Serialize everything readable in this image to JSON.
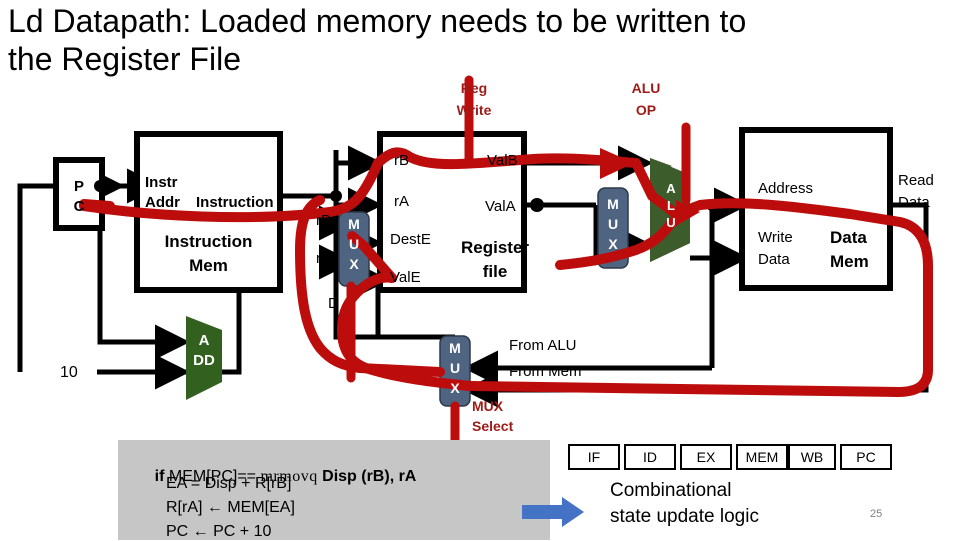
{
  "slide": {
    "title": "Ld Datapath: Loaded memory needs to be written to the Register File",
    "page_number": "25"
  },
  "colors": {
    "annotation_red": "#bd0c0c",
    "label_red": "#9e1b17",
    "alu_green": "#3d5c2b",
    "mux_blue": "#4f6480",
    "blue_arrow": "#4472c4",
    "code_bg": "#c6c6c6",
    "wire_black": "#000000"
  },
  "diagram": {
    "pc_box": {
      "line1": "P",
      "line2": "C"
    },
    "instr_mem": {
      "in_label_line1": "Instr",
      "in_label_line2": "Addr",
      "out_label": "Instruction",
      "title_line1": "Instruction",
      "title_line2": "Mem"
    },
    "adder": {
      "line1": "A",
      "line2": "DD",
      "increment": "10"
    },
    "decode_mux": {
      "glyph": "MUX",
      "in_top": "rB",
      "in_bottom": "rA",
      "in_extra": "D"
    },
    "register_file": {
      "title_line1": "Register",
      "title_line2": "file",
      "inputs": [
        "rB",
        "rA",
        "DestE",
        "ValE"
      ],
      "outputs": [
        "ValB",
        "ValA"
      ],
      "control_label_line1": "Reg",
      "control_label_line2": "Write"
    },
    "exec_mux": {
      "glyph": "MUX"
    },
    "alu": {
      "glyph": "ALU",
      "control_label_line1": "ALU",
      "control_label_line2": "OP"
    },
    "data_mem": {
      "address_label": "Address",
      "write_data_line1": "Write",
      "write_data_line2": "Data",
      "read_data_line1": "Read",
      "read_data_line2": "Data",
      "title_line1": "Data",
      "title_line2": "Mem"
    },
    "writeback_mux": {
      "glyph": "MUX",
      "in_top": "From ALU",
      "in_bottom": "From Mem",
      "select_line1": "MUX",
      "select_line2": "Select"
    }
  },
  "code": {
    "line1_a": "if ",
    "line1_b": "MEM[PC]== ",
    "line1_mono": "mrmovq",
    "line1_c": " Disp (rB), rA",
    "line2": "EA = Disp + R[rB]",
    "line3": "R[rA] ← MEM[EA]",
    "line4": "PC ← PC + 10"
  },
  "stages": {
    "boxes": [
      "IF",
      "ID",
      "EX",
      "MEM",
      "WB",
      "PC"
    ],
    "caption_line1": "Combinational",
    "caption_line2": "state update logic"
  }
}
